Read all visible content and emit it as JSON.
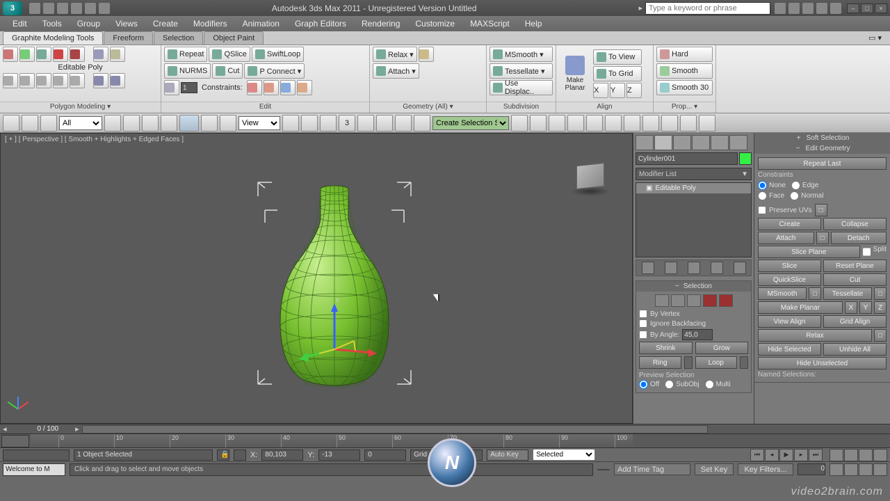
{
  "title": "Autodesk 3ds Max 2011 - Unregistered Version   Untitled",
  "search_placeholder": "Type a keyword or phrase",
  "menu": [
    "Edit",
    "Tools",
    "Group",
    "Views",
    "Create",
    "Modifiers",
    "Animation",
    "Graph Editors",
    "Rendering",
    "Customize",
    "MAXScript",
    "Help"
  ],
  "ribbon_tabs": [
    "Graphite Modeling Tools",
    "Freeform",
    "Selection",
    "Object Paint"
  ],
  "ribbon": {
    "polygon_modeling": {
      "label": "Polygon Modeling ▾",
      "editable_poly": "Editable Poly"
    },
    "edit": {
      "label": "Edit",
      "repeat": "Repeat",
      "nurms": "NURMS",
      "qslice": "QSlice",
      "cut": "Cut",
      "swiftloop": "SwiftLoop",
      "pconnect": "P Connect ▾",
      "constraints": "Constraints:",
      "spinner": "1"
    },
    "geometry": {
      "label": "Geometry (All) ▾",
      "relax": "Relax ▾",
      "attach": "Attach ▾"
    },
    "subdivision": {
      "label": "Subdivision",
      "msmooth": "MSmooth ▾",
      "tessellate": "Tessellate ▾",
      "displace": "Use Displac.."
    },
    "align": {
      "label": "Align",
      "make_planar": "Make Planar",
      "to_view": "To View",
      "to_grid": "To Grid",
      "x": "X",
      "y": "Y",
      "z": "Z"
    },
    "prop": {
      "label": "Prop... ▾",
      "hard": "Hard",
      "smooth": "Smooth",
      "smooth30": "Smooth 30"
    }
  },
  "maintoolbar": {
    "filter": "All",
    "space": "View",
    "create_sel_set": "Create Selection Se"
  },
  "viewport": {
    "label": "[ + ] [ Perspective ] [ Smooth + Highlights + Edged Faces ]",
    "axis_z": "z"
  },
  "command_panel": {
    "object_name": "Cylinder001",
    "modifier_list": "Modifier List",
    "stack_item": "Editable Poly",
    "selection": {
      "header": "Selection",
      "by_vertex": "By Vertex",
      "ignore_backfacing": "Ignore Backfacing",
      "by_angle": "By Angle:",
      "angle_val": "45,0",
      "shrink": "Shrink",
      "grow": "Grow",
      "ring": "Ring",
      "loop": "Loop",
      "preview": "Preview Selection",
      "off": "Off",
      "subobj": "SubObj",
      "multi": "Multi"
    }
  },
  "ep": {
    "soft_selection": "Soft Selection",
    "edit_geometry": "Edit Geometry",
    "repeat_last": "Repeat Last",
    "constraints": "Constraints",
    "none": "None",
    "edge": "Edge",
    "face": "Face",
    "normal": "Normal",
    "preserve_uvs": "Preserve UVs",
    "create": "Create",
    "collapse": "Collapse",
    "attach": "Attach",
    "detach": "Detach",
    "slice_plane": "Slice Plane",
    "split": "Split",
    "slice": "Slice",
    "reset_plane": "Reset Plane",
    "quickslice": "QuickSlice",
    "cut": "Cut",
    "msmooth": "MSmooth",
    "tessellate": "Tessellate",
    "make_planar": "Make Planar",
    "x": "X",
    "y": "Y",
    "z": "Z",
    "view_align": "View Align",
    "grid_align": "Grid Align",
    "relax": "Relax",
    "hide_selected": "Hide Selected",
    "unhide_all": "Unhide All",
    "hide_unselected": "Hide Unselected",
    "named_selections": "Named Selections:"
  },
  "timeline": {
    "pos": "0 / 100",
    "ticks": [
      "0",
      "10",
      "20",
      "30",
      "40",
      "50",
      "60",
      "70",
      "80",
      "90",
      "100"
    ]
  },
  "status": {
    "objects": "1 Object Selected",
    "x_label": "X:",
    "x_val": "80,103",
    "y_label": "Y:",
    "y_val": "-13",
    "z_label": "",
    "z_val": "0",
    "grid": "Grid = 10,0",
    "auto_key": "Auto Key",
    "set_key": "Set Key",
    "key_mode": "Selected",
    "key_filters": "Key Filters...",
    "frame": "0",
    "add_time_tag": "Add Time Tag",
    "welcome": "Welcome to M",
    "prompt": "Click and drag to select and move objects"
  },
  "watermark": "video2brain.com",
  "logo": "N"
}
